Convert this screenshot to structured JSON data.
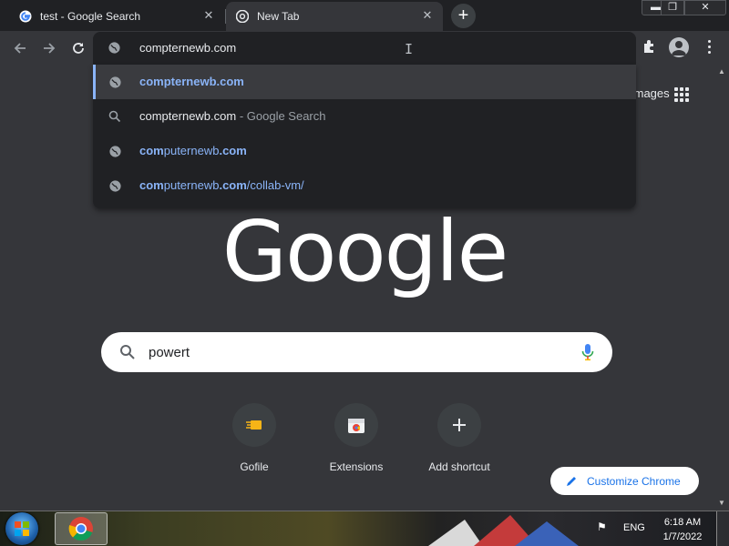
{
  "tabs": [
    {
      "title": "test - Google Search",
      "favicon": "google-g-icon",
      "active": false
    },
    {
      "title": "New Tab",
      "favicon": "chrome-icon",
      "active": true
    }
  ],
  "omnibox": {
    "text": "compternewb.com"
  },
  "suggestions": [
    {
      "icon": "globe-icon",
      "match": "compternewb.com",
      "rest": "",
      "suffix": "",
      "selected": true
    },
    {
      "icon": "search-icon",
      "match": "",
      "rest": "compternewb.com",
      "suffix": " - Google Search",
      "selected": false
    },
    {
      "icon": "globe-icon",
      "match": "com",
      "rest": "puternewb",
      "match2": ".com",
      "suffix": "",
      "selected": false
    },
    {
      "icon": "globe-icon",
      "match": "com",
      "rest": "puternewb",
      "match2": ".com",
      "suffix": "/collab-vm/",
      "selected": false
    }
  ],
  "header_links": {
    "images": "Images"
  },
  "logo": {
    "text": "Google"
  },
  "search": {
    "value": "powert"
  },
  "shortcuts": [
    {
      "label": "Gofile",
      "icon": "gofile-icon"
    },
    {
      "label": "Extensions",
      "icon": "extensions-icon"
    },
    {
      "label": "Add shortcut",
      "icon": "plus-icon"
    }
  ],
  "customize": {
    "label": "Customize Chrome"
  },
  "taskbar": {
    "lang": "ENG",
    "time": "6:18 AM",
    "date": "1/7/2022"
  },
  "colors": {
    "accent": "#8ab4f8",
    "background": "#35363a",
    "chrome_dark": "#202124",
    "link_blue": "#1a73e8"
  }
}
